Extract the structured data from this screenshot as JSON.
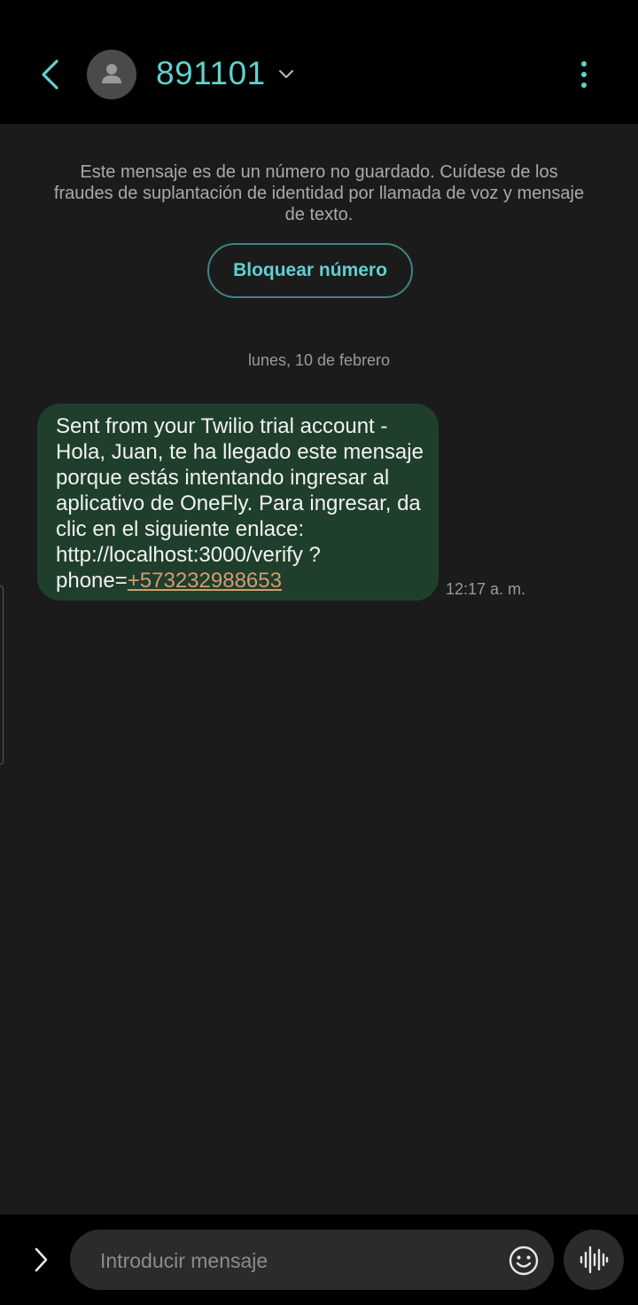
{
  "header": {
    "contact_name": "891101",
    "back_icon": "chevron-left-icon",
    "avatar_icon": "person-icon",
    "dropdown_icon": "chevron-down-icon",
    "more_icon": "more-vertical-icon",
    "accent_color": "#5fd1d0"
  },
  "conversation": {
    "warning_text": "Este mensaje es de un número no guardado. Cuídese de los fraudes de suplantación de identidad por llamada de voz y mensaje de texto.",
    "block_button_label": "Bloquear número",
    "date_separator": "lunes, 10 de febrero",
    "messages": [
      {
        "text_before_link": "Sent from your Twilio trial account - Hola, Juan, te ha llegado este mensaje porque estás intentando ingresar al aplicativo de OneFly. Para ingresar, da clic en el siguiente enlace: http://localhost:3000/verify ?phone=",
        "link_text": "+573232988653",
        "time": "12:17 a. m.",
        "bubble_color": "#1f3f2c",
        "link_color": "#d39b73"
      }
    ]
  },
  "composer": {
    "placeholder": "Introducir mensaje",
    "value": "",
    "expand_icon": "chevron-right-icon",
    "emoji_icon": "smiley-icon",
    "voice_icon": "voice-wave-icon"
  }
}
